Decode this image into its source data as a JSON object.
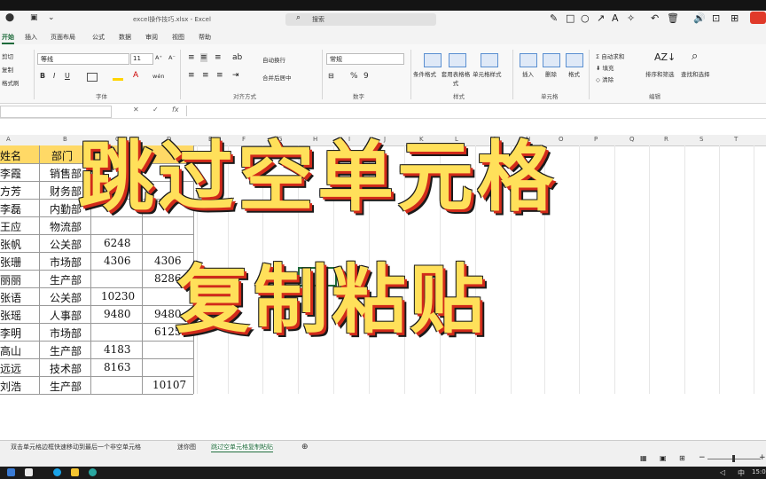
{
  "window": {
    "title": "excel操作技巧.xlsx - Excel",
    "search_placeholder": "搜索"
  },
  "quick_access": {
    "autosave_icon": "AutoSave",
    "save_icon": "save-icon",
    "undo_label": "↶",
    "more": "⌄"
  },
  "annotation_tools": [
    "✎",
    "□",
    "○",
    "↗",
    "A",
    "✧",
    "↶",
    "🗑",
    "🔊",
    "⊡",
    "⊞"
  ],
  "menu_tabs": [
    {
      "label": "开始",
      "active": true
    },
    {
      "label": "插入"
    },
    {
      "label": "页面布局"
    },
    {
      "label": "公式"
    },
    {
      "label": "数据"
    },
    {
      "label": "审阅"
    },
    {
      "label": "视图"
    },
    {
      "label": "帮助"
    }
  ],
  "ribbon": {
    "clipboard": {
      "cut": "剪切",
      "copy": "复制",
      "format_painter": "格式刷"
    },
    "font": {
      "name": "等线",
      "size": "11",
      "group": "字体",
      "grow": "A⁺",
      "shrink": "A⁻",
      "bold": "B",
      "italic": "I",
      "underline": "U",
      "wen": "wén"
    },
    "alignment": {
      "wrap": "自动换行",
      "merge": "合并后居中",
      "group": "对齐方式"
    },
    "number": {
      "format": "常规",
      "group": "数字",
      "percent": "%",
      "comma": "9"
    },
    "styles": {
      "conditional": "条件格式",
      "table": "套用表格格式",
      "cell_styles": "单元格样式",
      "group": "样式"
    },
    "cells": {
      "insert": "插入",
      "delete": "删除",
      "format": "格式",
      "group": "单元格"
    },
    "editing": {
      "autosum": "自动求和",
      "fill": "填充",
      "clear": "清除",
      "sort": "排序和筛选",
      "find": "查找和选择",
      "group": "编辑"
    }
  },
  "formula_bar": {
    "cancel": "✕",
    "enter": "✓",
    "fx": "fx"
  },
  "columns": [
    "A",
    "B",
    "C",
    "D",
    "E",
    "F",
    "G",
    "H",
    "I",
    "J",
    "K",
    "L",
    "M",
    "N",
    "O",
    "P",
    "Q",
    "R",
    "S",
    "T"
  ],
  "table": {
    "header": [
      "姓名",
      "部门"
    ],
    "rows": [
      [
        "李霞",
        "销售部",
        "",
        ""
      ],
      [
        "方芳",
        "财务部",
        "",
        ""
      ],
      [
        "李磊",
        "内勤部",
        "",
        ""
      ],
      [
        "王应",
        "物流部",
        "",
        ""
      ],
      [
        "张帆",
        "公关部",
        "6248",
        ""
      ],
      [
        "张珊",
        "市场部",
        "4306",
        "4306"
      ],
      [
        "丽丽",
        "生产部",
        "",
        "8286"
      ],
      [
        "张语",
        "公关部",
        "10230",
        ""
      ],
      [
        "张瑶",
        "人事部",
        "9480",
        "9480"
      ],
      [
        "李明",
        "市场部",
        "",
        "6125"
      ],
      [
        "高山",
        "生产部",
        "4183",
        ""
      ],
      [
        "远远",
        "技术部",
        "8163",
        ""
      ],
      [
        "刘浩",
        "生产部",
        "",
        "10107"
      ]
    ]
  },
  "overlay": {
    "line1": "跳过空单元格",
    "line2": "复制粘贴"
  },
  "sheet_tabs": [
    {
      "label": "双击单元格边框快速移动到最后一个非空单元格"
    },
    {
      "label": "迷你图"
    },
    {
      "label": "跳过空单元格复制粘贴",
      "active": true
    }
  ],
  "status": {
    "zoom_minus": "−",
    "zoom_plus": "+"
  },
  "taskbar": {
    "ime": "中",
    "clock": "15:0"
  }
}
